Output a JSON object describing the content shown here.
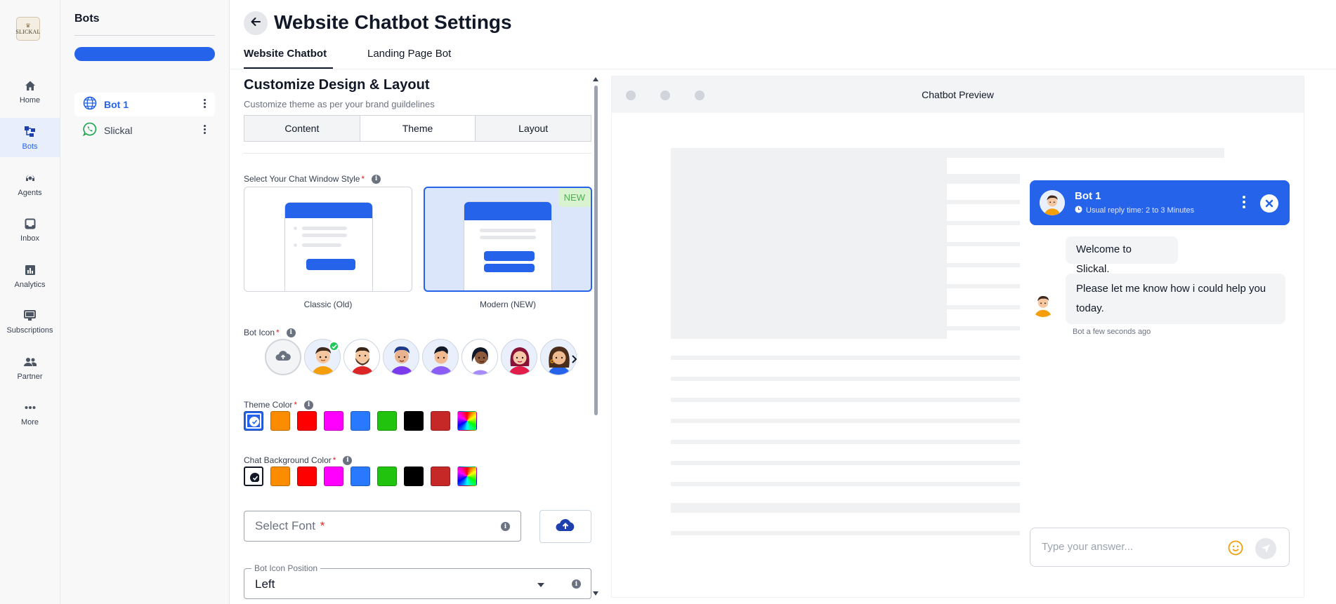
{
  "brand": {
    "logo_text": "SLICKAL",
    "accent": "#2563eb"
  },
  "nav": [
    {
      "label": "Home",
      "icon": "home-icon"
    },
    {
      "label": "Bots",
      "icon": "bots-icon",
      "active": true
    },
    {
      "label": "Agents",
      "icon": "agents-icon"
    },
    {
      "label": "Inbox",
      "icon": "inbox-icon"
    },
    {
      "label": "Analytics",
      "icon": "analytics-icon"
    },
    {
      "label": "Subscriptions",
      "icon": "subscriptions-icon"
    },
    {
      "label": "Partner",
      "icon": "partner-icon"
    },
    {
      "label": "More",
      "icon": "more-icon"
    }
  ],
  "bots_panel": {
    "title": "Bots",
    "items": [
      {
        "name": "Bot 1",
        "icon": "globe-icon",
        "active": true
      },
      {
        "name": "Slickal",
        "icon": "whatsapp-icon"
      }
    ]
  },
  "header": {
    "title": "Website Chatbot Settings",
    "tabs": [
      {
        "label": "Website Chatbot",
        "active": true
      },
      {
        "label": "Landing Page Bot"
      }
    ]
  },
  "settings": {
    "section_title": "Customize Design & Layout",
    "section_subtitle": "Customize theme as per your brand guildelines",
    "segments": [
      {
        "label": "Content"
      },
      {
        "label": "Theme",
        "active": true
      },
      {
        "label": "Layout"
      }
    ],
    "window_style": {
      "label": "Select Your Chat Window Style",
      "options": [
        {
          "caption": "Classic (Old)"
        },
        {
          "caption": "Modern (NEW)",
          "badge": "NEW",
          "selected": true
        }
      ]
    },
    "bot_icon": {
      "label": "Bot Icon",
      "selected_index": 0,
      "avatars": [
        "avatar-boy-orange",
        "avatar-man-beard",
        "avatar-man-purple",
        "avatar-man-purple-2",
        "avatar-woman-purple",
        "avatar-woman-red",
        "avatar-woman-blue"
      ]
    },
    "theme_color": {
      "label": "Theme Color",
      "selected": "#2563eb",
      "colors": [
        "#2563eb",
        "#fb8c00",
        "#ff0000",
        "#ff00ff",
        "#2979ff",
        "#22c30e",
        "#000000",
        "#c62828",
        "rainbow"
      ]
    },
    "chat_bg_color": {
      "label": "Chat Background Color",
      "selected": "#ffffff",
      "colors": [
        "#ffffff",
        "#fb8c00",
        "#ff0000",
        "#ff00ff",
        "#2979ff",
        "#22c30e",
        "#000000",
        "#c62828",
        "rainbow"
      ]
    },
    "font": {
      "placeholder": "Select Font",
      "required_mark": "*"
    },
    "icon_position": {
      "legend": "Bot Icon Position",
      "value": "Left"
    }
  },
  "preview": {
    "title": "Chatbot Preview",
    "bot_name": "Bot 1",
    "reply_time": "Usual reply time: 2 to 3 Minutes",
    "messages": [
      "Welcome to Slickal.",
      "Please let me know how i could help you today."
    ],
    "timestamp": "Bot a few seconds ago",
    "input_placeholder": "Type your answer..."
  }
}
